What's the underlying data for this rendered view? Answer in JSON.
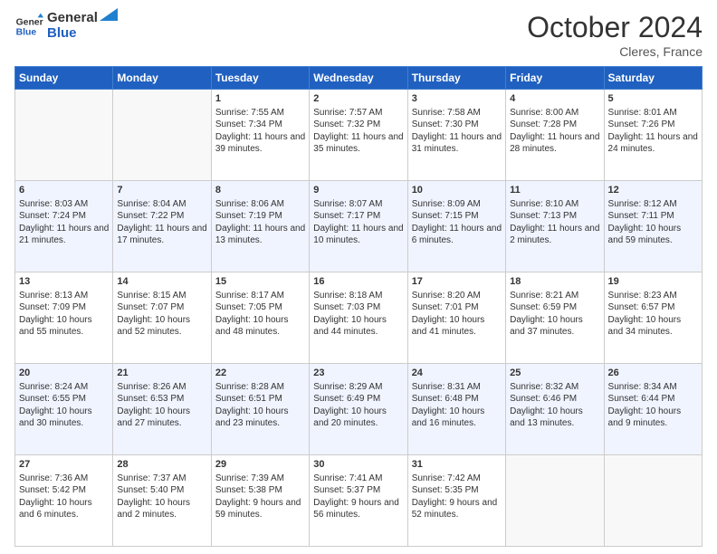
{
  "logo": {
    "line1": "General",
    "line2": "Blue"
  },
  "title": "October 2024",
  "location": "Cleres, France",
  "weekdays": [
    "Sunday",
    "Monday",
    "Tuesday",
    "Wednesday",
    "Thursday",
    "Friday",
    "Saturday"
  ],
  "weeks": [
    [
      {
        "day": "",
        "sunrise": "",
        "sunset": "",
        "daylight": ""
      },
      {
        "day": "",
        "sunrise": "",
        "sunset": "",
        "daylight": ""
      },
      {
        "day": "1",
        "sunrise": "Sunrise: 7:55 AM",
        "sunset": "Sunset: 7:34 PM",
        "daylight": "Daylight: 11 hours and 39 minutes."
      },
      {
        "day": "2",
        "sunrise": "Sunrise: 7:57 AM",
        "sunset": "Sunset: 7:32 PM",
        "daylight": "Daylight: 11 hours and 35 minutes."
      },
      {
        "day": "3",
        "sunrise": "Sunrise: 7:58 AM",
        "sunset": "Sunset: 7:30 PM",
        "daylight": "Daylight: 11 hours and 31 minutes."
      },
      {
        "day": "4",
        "sunrise": "Sunrise: 8:00 AM",
        "sunset": "Sunset: 7:28 PM",
        "daylight": "Daylight: 11 hours and 28 minutes."
      },
      {
        "day": "5",
        "sunrise": "Sunrise: 8:01 AM",
        "sunset": "Sunset: 7:26 PM",
        "daylight": "Daylight: 11 hours and 24 minutes."
      }
    ],
    [
      {
        "day": "6",
        "sunrise": "Sunrise: 8:03 AM",
        "sunset": "Sunset: 7:24 PM",
        "daylight": "Daylight: 11 hours and 21 minutes."
      },
      {
        "day": "7",
        "sunrise": "Sunrise: 8:04 AM",
        "sunset": "Sunset: 7:22 PM",
        "daylight": "Daylight: 11 hours and 17 minutes."
      },
      {
        "day": "8",
        "sunrise": "Sunrise: 8:06 AM",
        "sunset": "Sunset: 7:19 PM",
        "daylight": "Daylight: 11 hours and 13 minutes."
      },
      {
        "day": "9",
        "sunrise": "Sunrise: 8:07 AM",
        "sunset": "Sunset: 7:17 PM",
        "daylight": "Daylight: 11 hours and 10 minutes."
      },
      {
        "day": "10",
        "sunrise": "Sunrise: 8:09 AM",
        "sunset": "Sunset: 7:15 PM",
        "daylight": "Daylight: 11 hours and 6 minutes."
      },
      {
        "day": "11",
        "sunrise": "Sunrise: 8:10 AM",
        "sunset": "Sunset: 7:13 PM",
        "daylight": "Daylight: 11 hours and 2 minutes."
      },
      {
        "day": "12",
        "sunrise": "Sunrise: 8:12 AM",
        "sunset": "Sunset: 7:11 PM",
        "daylight": "Daylight: 10 hours and 59 minutes."
      }
    ],
    [
      {
        "day": "13",
        "sunrise": "Sunrise: 8:13 AM",
        "sunset": "Sunset: 7:09 PM",
        "daylight": "Daylight: 10 hours and 55 minutes."
      },
      {
        "day": "14",
        "sunrise": "Sunrise: 8:15 AM",
        "sunset": "Sunset: 7:07 PM",
        "daylight": "Daylight: 10 hours and 52 minutes."
      },
      {
        "day": "15",
        "sunrise": "Sunrise: 8:17 AM",
        "sunset": "Sunset: 7:05 PM",
        "daylight": "Daylight: 10 hours and 48 minutes."
      },
      {
        "day": "16",
        "sunrise": "Sunrise: 8:18 AM",
        "sunset": "Sunset: 7:03 PM",
        "daylight": "Daylight: 10 hours and 44 minutes."
      },
      {
        "day": "17",
        "sunrise": "Sunrise: 8:20 AM",
        "sunset": "Sunset: 7:01 PM",
        "daylight": "Daylight: 10 hours and 41 minutes."
      },
      {
        "day": "18",
        "sunrise": "Sunrise: 8:21 AM",
        "sunset": "Sunset: 6:59 PM",
        "daylight": "Daylight: 10 hours and 37 minutes."
      },
      {
        "day": "19",
        "sunrise": "Sunrise: 8:23 AM",
        "sunset": "Sunset: 6:57 PM",
        "daylight": "Daylight: 10 hours and 34 minutes."
      }
    ],
    [
      {
        "day": "20",
        "sunrise": "Sunrise: 8:24 AM",
        "sunset": "Sunset: 6:55 PM",
        "daylight": "Daylight: 10 hours and 30 minutes."
      },
      {
        "day": "21",
        "sunrise": "Sunrise: 8:26 AM",
        "sunset": "Sunset: 6:53 PM",
        "daylight": "Daylight: 10 hours and 27 minutes."
      },
      {
        "day": "22",
        "sunrise": "Sunrise: 8:28 AM",
        "sunset": "Sunset: 6:51 PM",
        "daylight": "Daylight: 10 hours and 23 minutes."
      },
      {
        "day": "23",
        "sunrise": "Sunrise: 8:29 AM",
        "sunset": "Sunset: 6:49 PM",
        "daylight": "Daylight: 10 hours and 20 minutes."
      },
      {
        "day": "24",
        "sunrise": "Sunrise: 8:31 AM",
        "sunset": "Sunset: 6:48 PM",
        "daylight": "Daylight: 10 hours and 16 minutes."
      },
      {
        "day": "25",
        "sunrise": "Sunrise: 8:32 AM",
        "sunset": "Sunset: 6:46 PM",
        "daylight": "Daylight: 10 hours and 13 minutes."
      },
      {
        "day": "26",
        "sunrise": "Sunrise: 8:34 AM",
        "sunset": "Sunset: 6:44 PM",
        "daylight": "Daylight: 10 hours and 9 minutes."
      }
    ],
    [
      {
        "day": "27",
        "sunrise": "Sunrise: 7:36 AM",
        "sunset": "Sunset: 5:42 PM",
        "daylight": "Daylight: 10 hours and 6 minutes."
      },
      {
        "day": "28",
        "sunrise": "Sunrise: 7:37 AM",
        "sunset": "Sunset: 5:40 PM",
        "daylight": "Daylight: 10 hours and 2 minutes."
      },
      {
        "day": "29",
        "sunrise": "Sunrise: 7:39 AM",
        "sunset": "Sunset: 5:38 PM",
        "daylight": "Daylight: 9 hours and 59 minutes."
      },
      {
        "day": "30",
        "sunrise": "Sunrise: 7:41 AM",
        "sunset": "Sunset: 5:37 PM",
        "daylight": "Daylight: 9 hours and 56 minutes."
      },
      {
        "day": "31",
        "sunrise": "Sunrise: 7:42 AM",
        "sunset": "Sunset: 5:35 PM",
        "daylight": "Daylight: 9 hours and 52 minutes."
      },
      {
        "day": "",
        "sunrise": "",
        "sunset": "",
        "daylight": ""
      },
      {
        "day": "",
        "sunrise": "",
        "sunset": "",
        "daylight": ""
      }
    ]
  ]
}
